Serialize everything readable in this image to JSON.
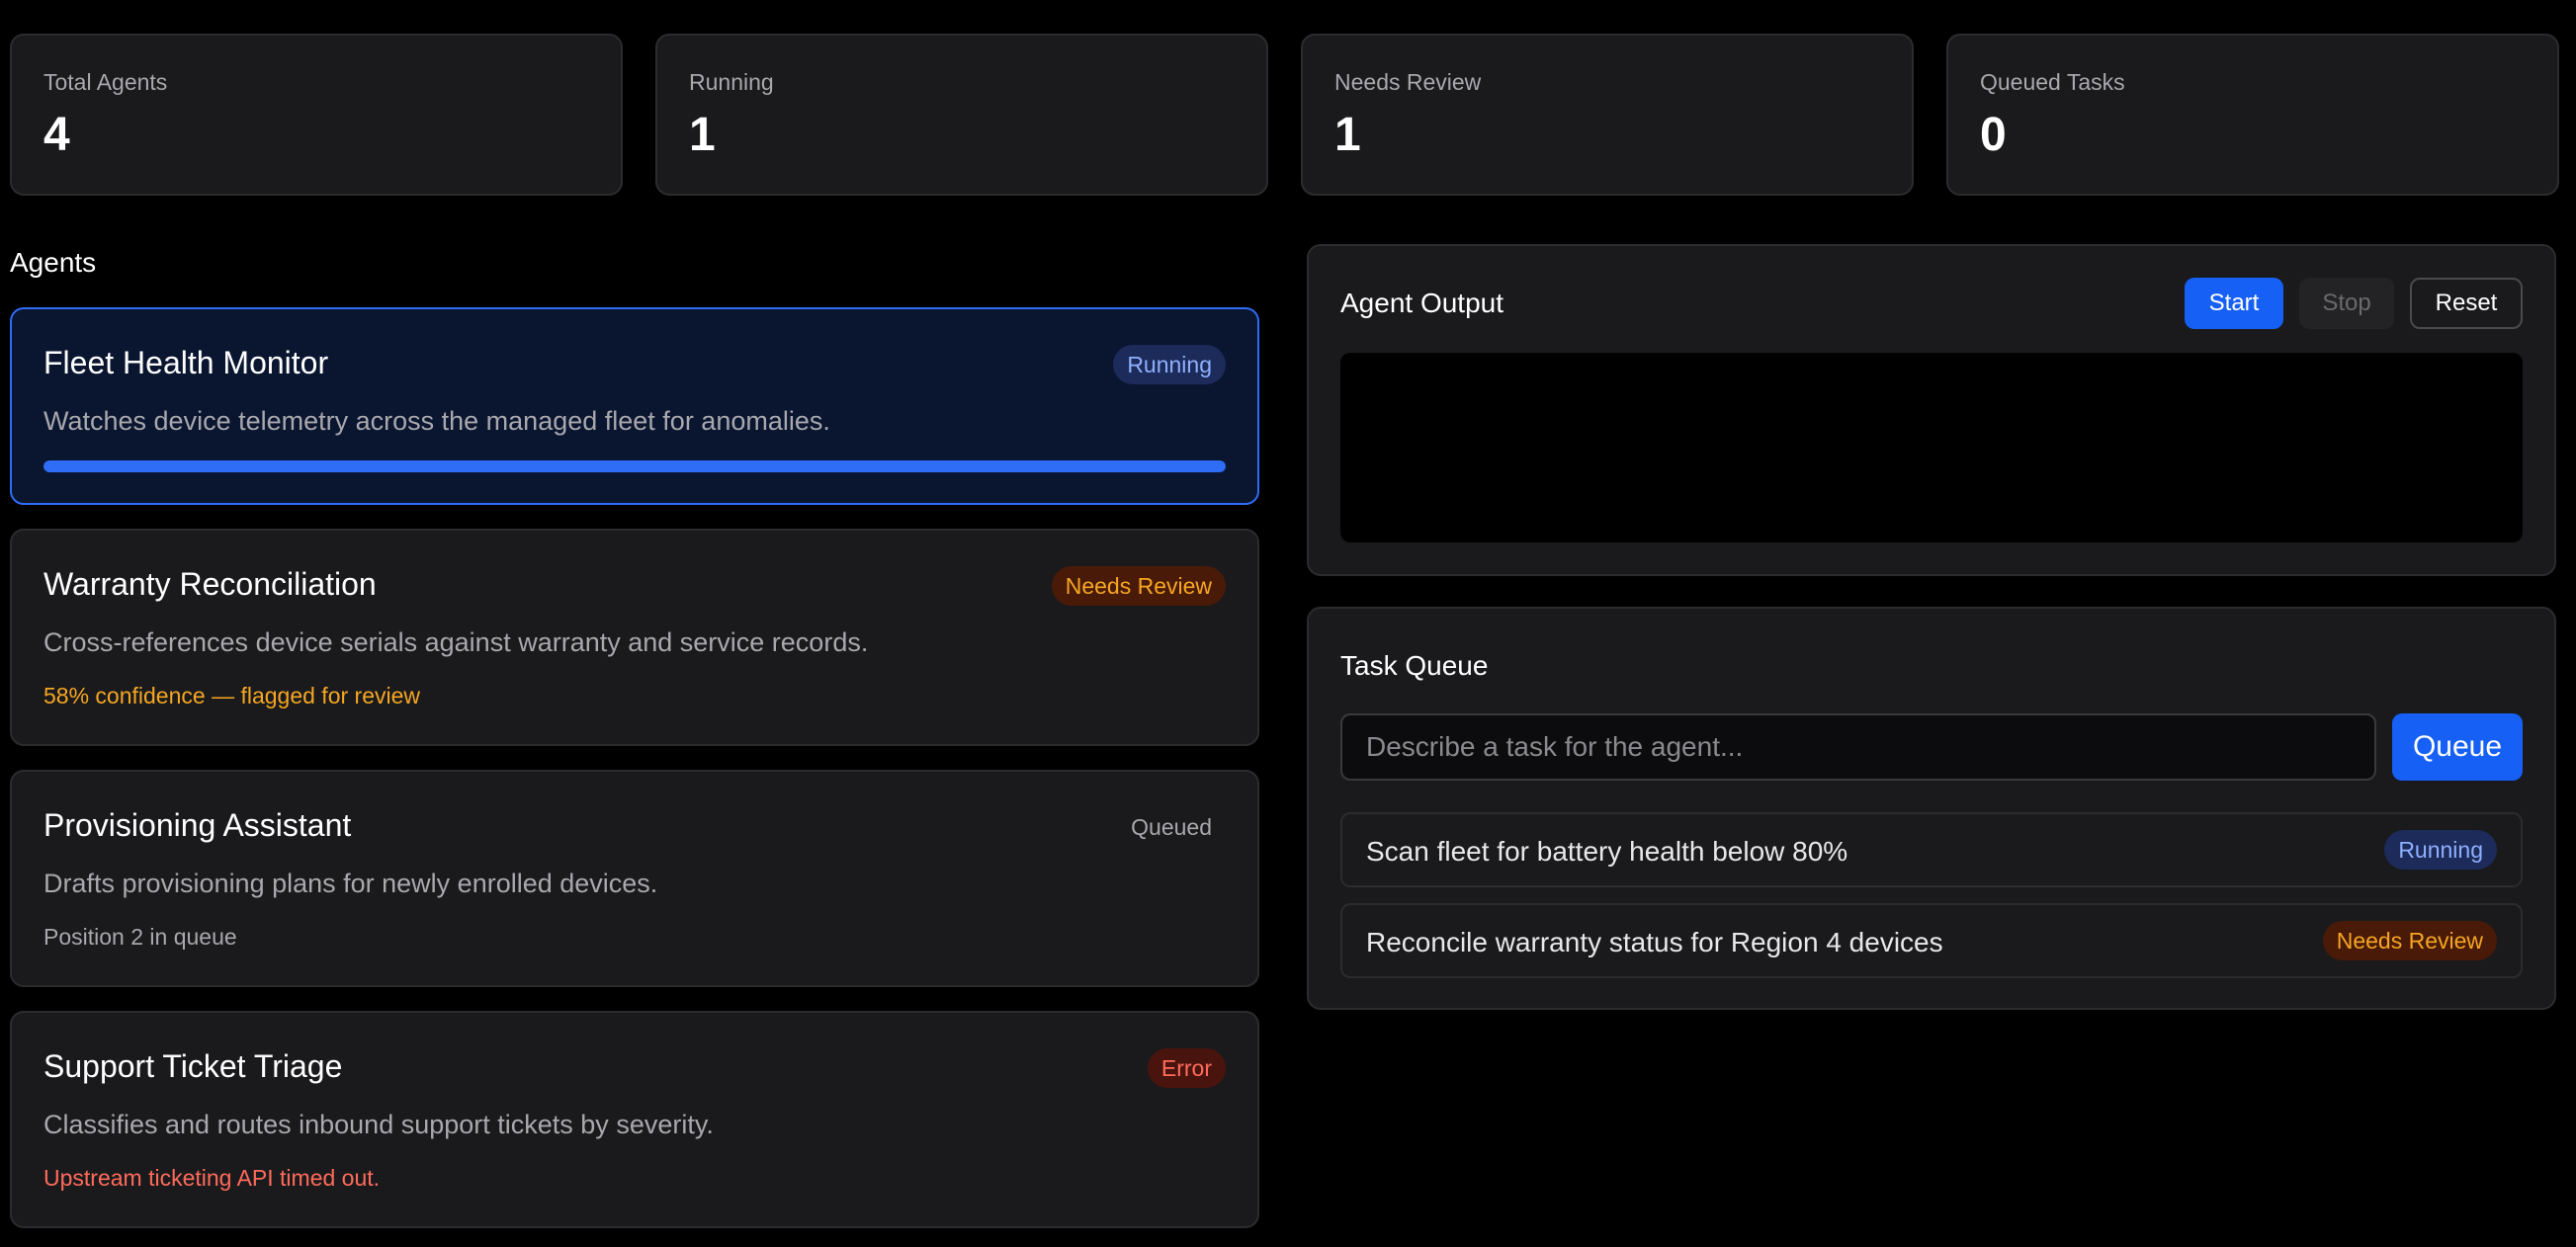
{
  "stats": [
    {
      "label": "Total Agents",
      "value": "4"
    },
    {
      "label": "Running",
      "value": "1"
    },
    {
      "label": "Needs Review",
      "value": "1"
    },
    {
      "label": "Queued Tasks",
      "value": "0"
    }
  ],
  "agents_heading": "Agents",
  "agents": [
    {
      "name": "Fleet Health Monitor",
      "status": "Running",
      "description": "Watches device telemetry across the managed fleet for anomalies.",
      "progress": 1.0
    },
    {
      "name": "Warranty Reconciliation",
      "status": "Needs Review",
      "description": "Cross-references device serials against warranty and service records.",
      "note": "58% confidence — flagged for review"
    },
    {
      "name": "Provisioning Assistant",
      "status": "Queued",
      "description": "Drafts provisioning plans for newly enrolled devices.",
      "note": "Position 2 in queue"
    },
    {
      "name": "Support Ticket Triage",
      "status": "Error",
      "description": "Classifies and routes inbound support tickets by severity.",
      "note": "Upstream ticketing API timed out."
    }
  ],
  "output": {
    "title": "Agent Output",
    "start_label": "Start",
    "stop_label": "Stop",
    "reset_label": "Reset"
  },
  "queue": {
    "title": "Task Queue",
    "placeholder": "Describe a task for the agent...",
    "button_label": "Queue",
    "tasks": [
      {
        "text": "Scan fleet for battery health below 80%",
        "status": "Running"
      },
      {
        "text": "Reconcile warranty status for Region 4 devices",
        "status": "Needs Review"
      }
    ]
  },
  "colors": {
    "accent": "#1660f5",
    "running": "#8fb0ff",
    "needs_review": "#f5a623",
    "error": "#ff6b5b"
  }
}
